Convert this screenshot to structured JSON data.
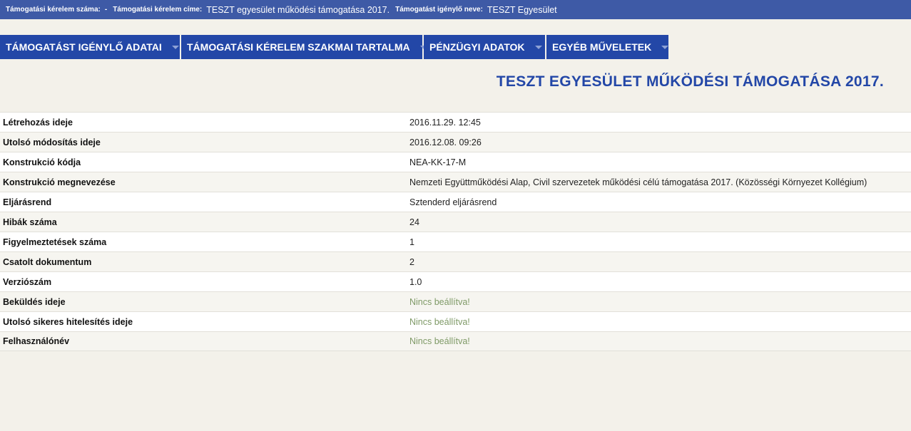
{
  "header": {
    "request_number_label": "Támogatási kérelem száma:",
    "request_number_value": "-",
    "request_title_label": "Támogatási kérelem címe:",
    "request_title_value": "TESZT egyesület működési támogatása 2017.",
    "applicant_label": "Támogatást igénylő neve:",
    "applicant_value": "TESZT Egyesület"
  },
  "menu": {
    "items": [
      {
        "label": "TÁMOGATÁST IGÉNYLŐ ADATAI"
      },
      {
        "label": "TÁMOGATÁSI KÉRELEM SZAKMAI TARTALMA"
      },
      {
        "label": "PÉNZÜGYI ADATOK"
      },
      {
        "label": "EGYÉB MŰVELETEK"
      }
    ]
  },
  "main": {
    "title": "TESZT EGYESÜLET MŰKÖDÉSI TÁMOGATÁSA 2017.",
    "rows": [
      {
        "key": "Létrehozás ideje",
        "value": "2016.11.29. 12:45"
      },
      {
        "key": "Utolsó módosítás ideje",
        "value": "2016.12.08. 09:26"
      },
      {
        "key": "Konstrukció kódja",
        "value": "NEA-KK-17-M"
      },
      {
        "key": "Konstrukció megnevezése",
        "value": "Nemzeti Együttműködési Alap, Civil szervezetek működési célú támogatása 2017. (Közösségi Környezet Kollégium)"
      },
      {
        "key": "Eljárásrend",
        "value": "Sztenderd eljárásrend"
      },
      {
        "key": "Hibák száma",
        "value": "24"
      },
      {
        "key": "Figyelmeztetések száma",
        "value": "1"
      },
      {
        "key": "Csatolt dokumentum",
        "value": "2"
      },
      {
        "key": "Verziószám",
        "value": "1.0"
      },
      {
        "key": "Beküldés ideje",
        "value": "Nincs beállítva!"
      },
      {
        "key": "Utolsó sikeres hitelesítés ideje",
        "value": "Nincs beállítva!"
      },
      {
        "key": "Felhasználónév",
        "value": "Nincs beállítva!"
      }
    ]
  },
  "colors": {
    "header_bg": "#3e5aa6",
    "menu_bg": "#2347a7",
    "title_color": "#2347a7",
    "unset_value_color": "#7f9a67",
    "page_bg": "#f3f1ea"
  }
}
